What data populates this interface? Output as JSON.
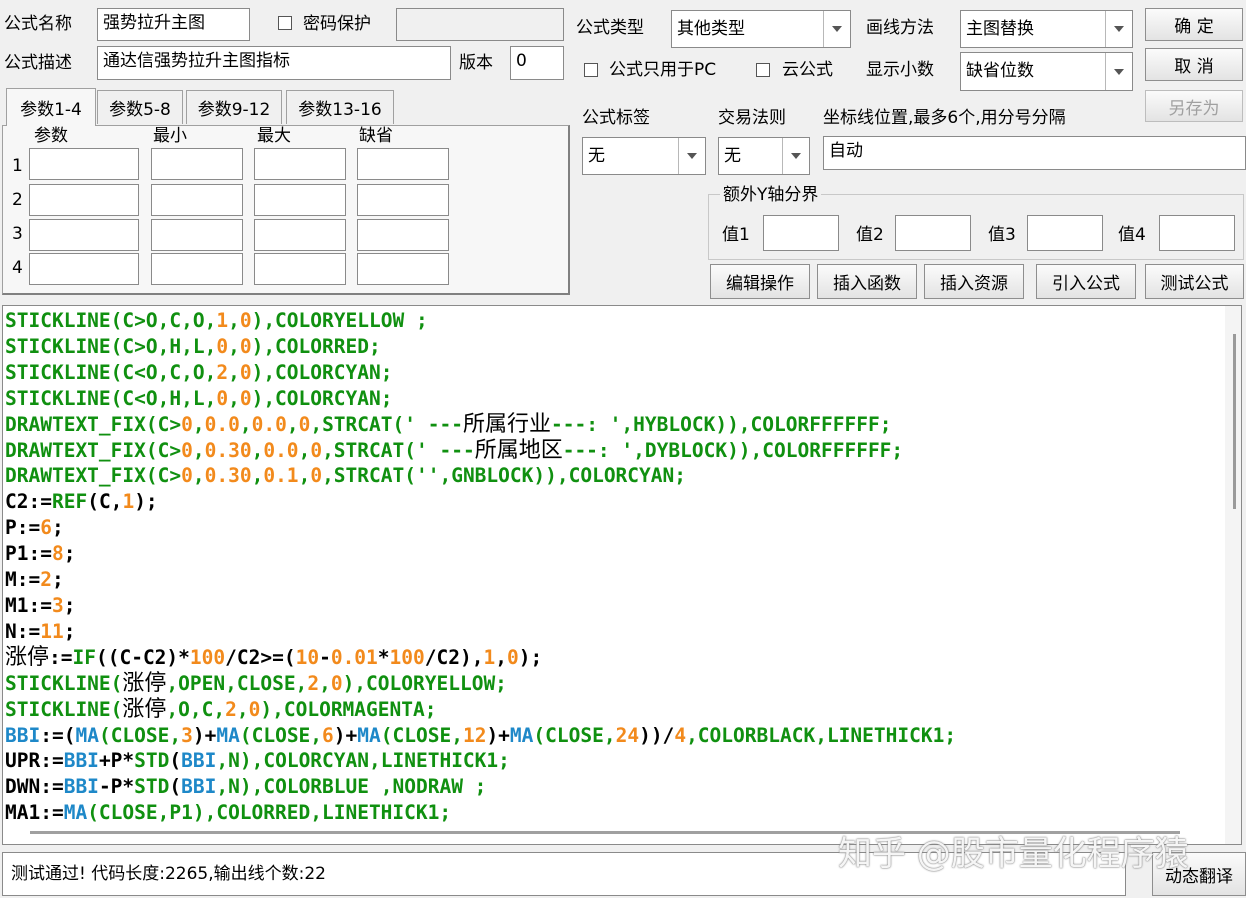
{
  "form": {
    "name_label": "公式名称",
    "name_value": "强势拉升主图",
    "password_label": "密码保护",
    "desc_label": "公式描述",
    "desc_value": "通达信强势拉升主图指标",
    "version_label": "版本",
    "version_value": "0",
    "type_label": "公式类型",
    "type_value": "其他类型",
    "draw_label": "画线方法",
    "draw_value": "主图替换",
    "pc_only_label": "公式只用于PC",
    "cloud_label": "云公式",
    "decimals_label": "显示小数",
    "decimals_value": "缺省位数",
    "tag_label": "公式标签",
    "tag_value": "无",
    "rule_label": "交易法则",
    "rule_value": "无",
    "coord_label": "坐标线位置,最多6个,用分号分隔",
    "coord_value": "自动",
    "yaxis_label": "额外Y轴分界",
    "y_values": [
      "值1",
      "值2",
      "值3",
      "值4"
    ]
  },
  "buttons": {
    "ok": "确  定",
    "cancel": "取  消",
    "save_as": "另存为",
    "edit": "编辑操作",
    "insert_func": "插入函数",
    "insert_res": "插入资源",
    "import": "引入公式",
    "test": "测试公式",
    "translate": "动态翻译"
  },
  "params": {
    "tabs": [
      "参数1-4",
      "参数5-8",
      "参数9-12",
      "参数13-16"
    ],
    "headers": [
      "参数",
      "最小",
      "最大",
      "缺省"
    ],
    "rows": [
      "1",
      "2",
      "3",
      "4"
    ]
  },
  "colors": {
    "function": "#109010",
    "number": "#f28a1c",
    "builtin": "#1e88c8",
    "text": "#000000"
  },
  "code_lines": [
    [
      [
        "STICKLINE(C>O,C,O,",
        "f"
      ],
      [
        "1",
        "n"
      ],
      [
        ",",
        "f"
      ],
      [
        "0",
        "n"
      ],
      [
        "),COLORYELLOW ;",
        "f"
      ]
    ],
    [
      [
        "STICKLINE(C>O,H,L,",
        "f"
      ],
      [
        "0",
        "n"
      ],
      [
        ",",
        "f"
      ],
      [
        "0",
        "n"
      ],
      [
        "),COLORRED;",
        "f"
      ]
    ],
    [
      [
        "STICKLINE(C<O,C,O,",
        "f"
      ],
      [
        "2",
        "n"
      ],
      [
        ",",
        "f"
      ],
      [
        "0",
        "n"
      ],
      [
        "),COLORCYAN;",
        "f"
      ]
    ],
    [
      [
        "STICKLINE(C<O,H,L,",
        "f"
      ],
      [
        "0",
        "n"
      ],
      [
        ",",
        "f"
      ],
      [
        "0",
        "n"
      ],
      [
        "),COLORCYAN;",
        "f"
      ]
    ],
    [
      [
        "DRAWTEXT_FIX(C>",
        "f"
      ],
      [
        "0",
        "n"
      ],
      [
        ",",
        "f"
      ],
      [
        "0.0",
        "n"
      ],
      [
        ",",
        "f"
      ],
      [
        "0.0",
        "n"
      ],
      [
        ",",
        "f"
      ],
      [
        "0",
        "n"
      ],
      [
        ",STRCAT(' ---",
        "f"
      ],
      [
        "所属行业",
        "cjk"
      ],
      [
        "---: ',HYBLOCK)),COLORFFFFFF;",
        "f"
      ]
    ],
    [
      [
        "DRAWTEXT_FIX(C>",
        "f"
      ],
      [
        "0",
        "n"
      ],
      [
        ",",
        "f"
      ],
      [
        "0.30",
        "n"
      ],
      [
        ",",
        "f"
      ],
      [
        "0.0",
        "n"
      ],
      [
        ",",
        "f"
      ],
      [
        "0",
        "n"
      ],
      [
        ",STRCAT(' ---",
        "f"
      ],
      [
        "所属地区",
        "cjk"
      ],
      [
        "---: ',DYBLOCK)),COLORFFFFFF;",
        "f"
      ]
    ],
    [
      [
        "DRAWTEXT_FIX(C>",
        "f"
      ],
      [
        "0",
        "n"
      ],
      [
        ",",
        "f"
      ],
      [
        "0.30",
        "n"
      ],
      [
        ",",
        "f"
      ],
      [
        "0.1",
        "n"
      ],
      [
        ",",
        "f"
      ],
      [
        "0",
        "n"
      ],
      [
        ",STRCAT('',GNBLOCK)),COLORCYAN;",
        "f"
      ]
    ],
    [
      [
        "C2:=",
        "k"
      ],
      [
        "REF",
        "f"
      ],
      [
        "(C,",
        "k"
      ],
      [
        "1",
        "n"
      ],
      [
        ");",
        "k"
      ]
    ],
    [
      [
        "P:=",
        "k"
      ],
      [
        "6",
        "n"
      ],
      [
        ";",
        "k"
      ]
    ],
    [
      [
        "P1:=",
        "k"
      ],
      [
        "8",
        "n"
      ],
      [
        ";",
        "k"
      ]
    ],
    [
      [
        "M:=",
        "k"
      ],
      [
        "2",
        "n"
      ],
      [
        ";",
        "k"
      ]
    ],
    [
      [
        "M1:=",
        "k"
      ],
      [
        "3",
        "n"
      ],
      [
        ";",
        "k"
      ]
    ],
    [
      [
        "N:=",
        "k"
      ],
      [
        "11",
        "n"
      ],
      [
        ";",
        "k"
      ]
    ],
    [
      [
        "涨停",
        "cjk"
      ],
      [
        ":=",
        "k"
      ],
      [
        "IF",
        "f"
      ],
      [
        "((C-C2)*",
        "k"
      ],
      [
        "100",
        "n"
      ],
      [
        "/C2>=(",
        "k"
      ],
      [
        "10",
        "n"
      ],
      [
        "-",
        "k"
      ],
      [
        "0.01",
        "n"
      ],
      [
        "*",
        "k"
      ],
      [
        "100",
        "n"
      ],
      [
        "/C2),",
        "k"
      ],
      [
        "1",
        "n"
      ],
      [
        ",",
        "k"
      ],
      [
        "0",
        "n"
      ],
      [
        ");",
        "k"
      ]
    ],
    [
      [
        "STICKLINE(",
        "f"
      ],
      [
        "涨停",
        "cjk"
      ],
      [
        ",OPEN,CLOSE,",
        "f"
      ],
      [
        "2",
        "n"
      ],
      [
        ",",
        "f"
      ],
      [
        "0",
        "n"
      ],
      [
        "),COLORYELLOW;",
        "f"
      ]
    ],
    [
      [
        "STICKLINE(",
        "f"
      ],
      [
        "涨停",
        "cjk"
      ],
      [
        ",O,C,",
        "f"
      ],
      [
        "2",
        "n"
      ],
      [
        ",",
        "f"
      ],
      [
        "0",
        "n"
      ],
      [
        "),COLORMAGENTA;",
        "f"
      ]
    ],
    [
      [
        "BBI",
        "b"
      ],
      [
        ":=(",
        "k"
      ],
      [
        "MA",
        "b"
      ],
      [
        "(CLOSE,",
        "f"
      ],
      [
        "3",
        "n"
      ],
      [
        ")+",
        "k"
      ],
      [
        "MA",
        "b"
      ],
      [
        "(CLOSE,",
        "f"
      ],
      [
        "6",
        "n"
      ],
      [
        ")+",
        "k"
      ],
      [
        "MA",
        "b"
      ],
      [
        "(CLOSE,",
        "f"
      ],
      [
        "12",
        "n"
      ],
      [
        ")+",
        "k"
      ],
      [
        "MA",
        "b"
      ],
      [
        "(CLOSE,",
        "f"
      ],
      [
        "24",
        "n"
      ],
      [
        "))/",
        "k"
      ],
      [
        "4",
        "n"
      ],
      [
        ",COLORBLACK,LINETHICK1;",
        "f"
      ]
    ],
    [
      [
        "UPR:=",
        "k"
      ],
      [
        "BBI",
        "b"
      ],
      [
        "+P*",
        "k"
      ],
      [
        "STD",
        "f"
      ],
      [
        "(",
        "k"
      ],
      [
        "BBI",
        "b"
      ],
      [
        ",N),COLORCYAN,LINETHICK1;",
        "f"
      ]
    ],
    [
      [
        "DWN:=",
        "k"
      ],
      [
        "BBI",
        "b"
      ],
      [
        "-P*",
        "k"
      ],
      [
        "STD",
        "f"
      ],
      [
        "(",
        "k"
      ],
      [
        "BBI",
        "b"
      ],
      [
        ",N),COLORBLUE ,NODRAW ;",
        "f"
      ]
    ],
    [
      [
        "MA1:=",
        "k"
      ],
      [
        "MA",
        "b"
      ],
      [
        "(CLOSE,P1),COLORRED,LINETHICK1;",
        "f"
      ]
    ]
  ],
  "status_text": "测试通过! 代码长度:2265,输出线个数:22",
  "watermark": "知乎 @股市量化程序猿"
}
